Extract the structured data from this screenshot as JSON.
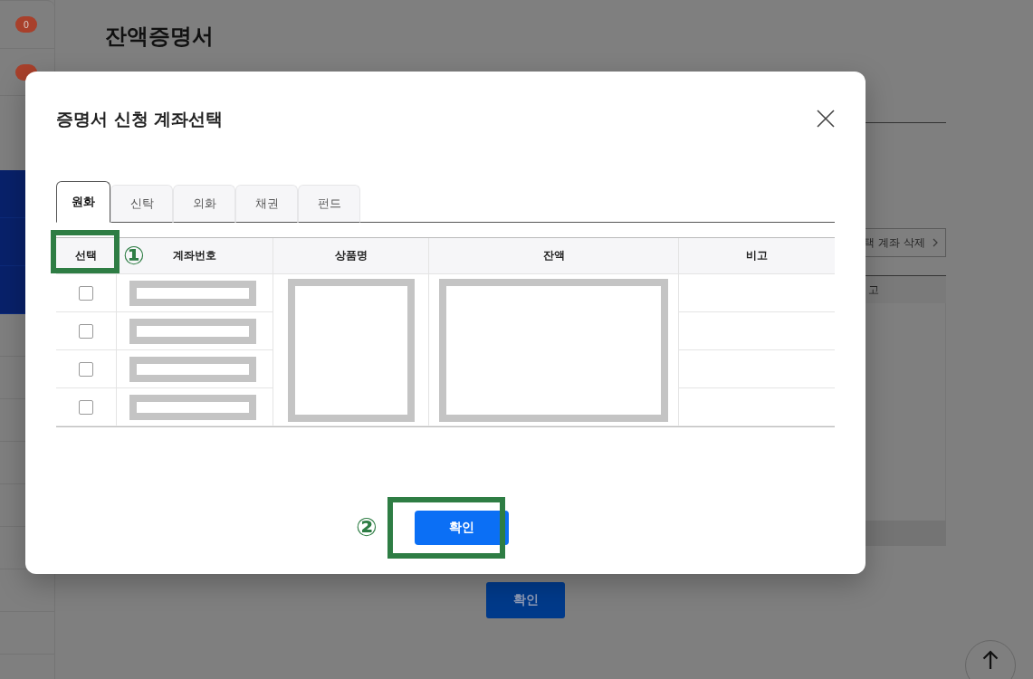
{
  "page": {
    "title": "잔액증명서",
    "badges": [
      {
        "count": "0"
      }
    ],
    "delete_button": "택 계좌 삭제",
    "table_column": "고",
    "confirm_button": "확인"
  },
  "modal": {
    "title": "증명서 신청 계좌선택",
    "tabs": [
      {
        "label": "원화",
        "selected": true
      },
      {
        "label": "신탁",
        "selected": false
      },
      {
        "label": "외화",
        "selected": false
      },
      {
        "label": "채권",
        "selected": false
      },
      {
        "label": "펀드",
        "selected": false
      }
    ],
    "table": {
      "columns": [
        "선택",
        "계좌번호",
        "상품명",
        "잔액",
        "비고"
      ],
      "rows": [
        {
          "checked": false
        },
        {
          "checked": false
        },
        {
          "checked": false
        },
        {
          "checked": false
        }
      ]
    },
    "confirm_button": "확인"
  },
  "annotations": [
    {
      "label": "①"
    },
    {
      "label": "②"
    }
  ]
}
